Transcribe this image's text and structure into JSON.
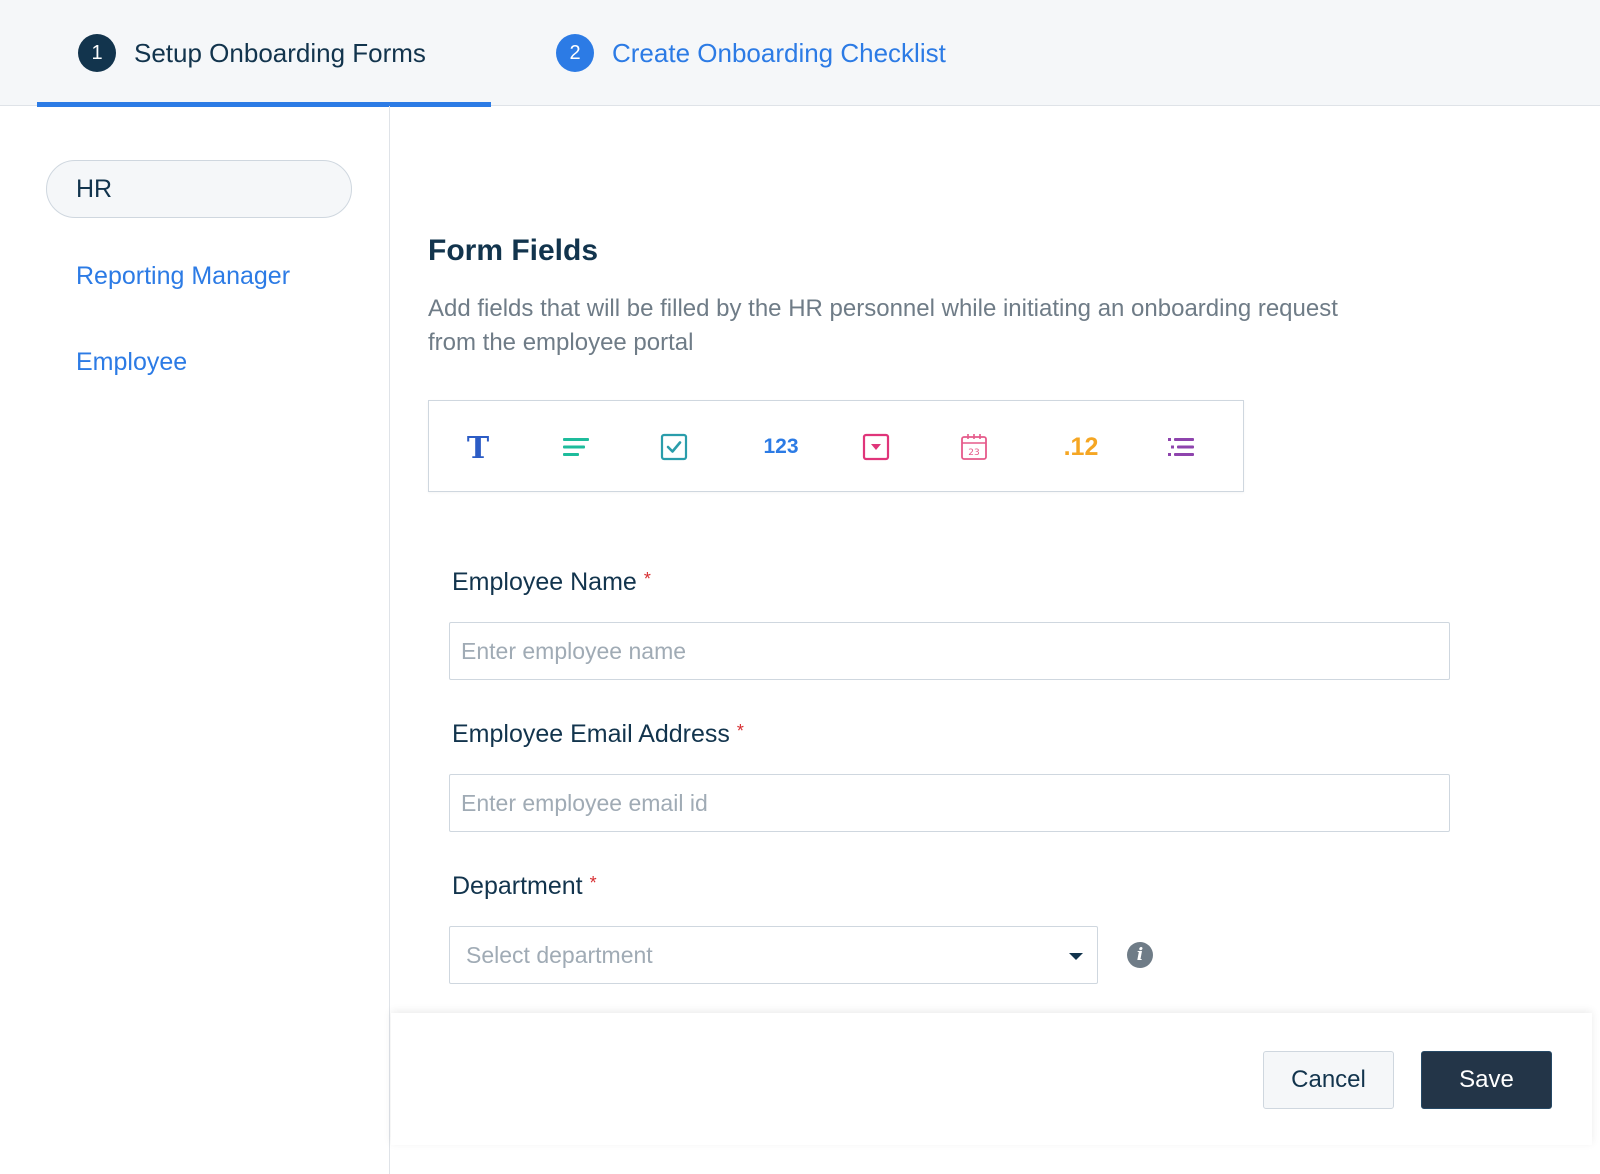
{
  "steps": [
    {
      "number": "1",
      "label": "Setup Onboarding Forms"
    },
    {
      "number": "2",
      "label": "Create Onboarding Checklist"
    }
  ],
  "sidebar": {
    "items": [
      {
        "label": "HR"
      },
      {
        "label": "Reporting Manager"
      },
      {
        "label": "Employee"
      }
    ]
  },
  "form": {
    "title": "Form Fields",
    "description": "Add fields that will be filled by the HR personnel while initiating an onboarding request from the employee portal",
    "toolbox": {
      "number_label": "123",
      "decimal_label": ".12",
      "colors": {
        "text": "#2c5cc5",
        "paragraph": "#1ebc9c",
        "checkbox": "#2a9dab",
        "number": "#2c7be5",
        "dropdown": "#e0357a",
        "date": "#e55a8a",
        "decimal": "#f5a623",
        "list": "#8e44ad"
      }
    },
    "fields": {
      "name": {
        "label": "Employee Name",
        "required_mark": "*",
        "placeholder": "Enter employee name"
      },
      "email": {
        "label": "Employee Email Address",
        "required_mark": "*",
        "placeholder": "Enter employee email id"
      },
      "department": {
        "label": "Department",
        "required_mark": "*",
        "placeholder": "Select department"
      }
    }
  },
  "footer": {
    "cancel_label": "Cancel",
    "save_label": "Save"
  }
}
